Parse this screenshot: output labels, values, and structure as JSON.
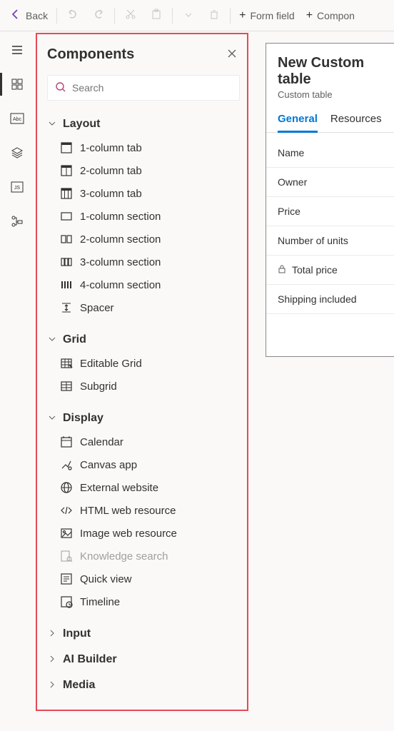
{
  "toolbar": {
    "back_label": "Back",
    "formfield_label": "Form field",
    "compon_label": "Compon"
  },
  "panel": {
    "title": "Components",
    "search_placeholder": "Search",
    "categories": [
      {
        "label": "Layout",
        "expanded": true,
        "items": [
          {
            "label": "1-column tab",
            "icon": "tab1"
          },
          {
            "label": "2-column tab",
            "icon": "tab2"
          },
          {
            "label": "3-column tab",
            "icon": "tab3"
          },
          {
            "label": "1-column section",
            "icon": "sec1"
          },
          {
            "label": "2-column section",
            "icon": "sec2"
          },
          {
            "label": "3-column section",
            "icon": "sec3"
          },
          {
            "label": "4-column section",
            "icon": "sec4"
          },
          {
            "label": "Spacer",
            "icon": "spacer"
          }
        ]
      },
      {
        "label": "Grid",
        "expanded": true,
        "items": [
          {
            "label": "Editable Grid",
            "icon": "egrid"
          },
          {
            "label": "Subgrid",
            "icon": "sgrid"
          }
        ]
      },
      {
        "label": "Display",
        "expanded": true,
        "items": [
          {
            "label": "Calendar",
            "icon": "cal"
          },
          {
            "label": "Canvas app",
            "icon": "canvas"
          },
          {
            "label": "External website",
            "icon": "globe"
          },
          {
            "label": "HTML web resource",
            "icon": "html"
          },
          {
            "label": "Image web resource",
            "icon": "img"
          },
          {
            "label": "Knowledge search",
            "icon": "knowledge",
            "disabled": true
          },
          {
            "label": "Quick view",
            "icon": "quick"
          },
          {
            "label": "Timeline",
            "icon": "timeline"
          }
        ]
      },
      {
        "label": "Input",
        "expanded": false,
        "items": []
      },
      {
        "label": "AI Builder",
        "expanded": false,
        "items": []
      },
      {
        "label": "Media",
        "expanded": false,
        "items": []
      }
    ]
  },
  "form": {
    "title": "New Custom table",
    "subtitle": "Custom table",
    "tabs": [
      {
        "label": "General",
        "active": true
      },
      {
        "label": "Resources",
        "active": false
      }
    ],
    "fields": [
      {
        "label": "Name",
        "locked": false
      },
      {
        "label": "Owner",
        "locked": false
      },
      {
        "label": "Price",
        "locked": false
      },
      {
        "label": "Number of units",
        "locked": false
      },
      {
        "label": "Total price",
        "locked": true
      },
      {
        "label": "Shipping included",
        "locked": false
      }
    ]
  }
}
